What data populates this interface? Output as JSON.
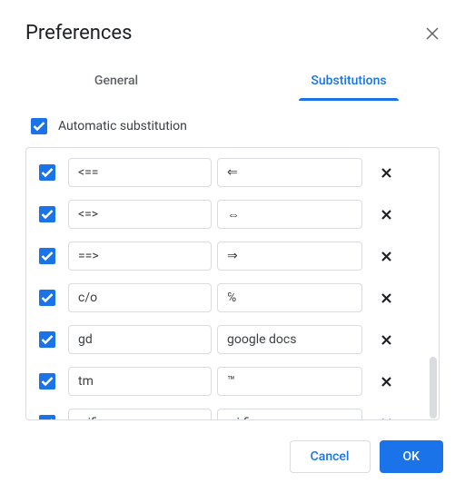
{
  "title": "Preferences",
  "tabs": {
    "general": "General",
    "substitutions": "Substitutions"
  },
  "autoSub": {
    "label": "Automatic substitution",
    "checked": true
  },
  "rows": [
    {
      "checked": true,
      "replace": "<==",
      "with": "⇐"
    },
    {
      "checked": true,
      "replace": "<=>",
      "with": "⇔"
    },
    {
      "checked": true,
      "replace": "==>",
      "with": "⇒"
    },
    {
      "checked": true,
      "replace": "c/o",
      "with": "℅"
    },
    {
      "checked": true,
      "replace": "gd",
      "with": "google docs"
    },
    {
      "checked": true,
      "replace": "tm",
      "with": "™"
    },
    {
      "checked": true,
      "replace": "wifi",
      "with": "wi-fi"
    }
  ],
  "buttons": {
    "cancel": "Cancel",
    "ok": "OK"
  }
}
